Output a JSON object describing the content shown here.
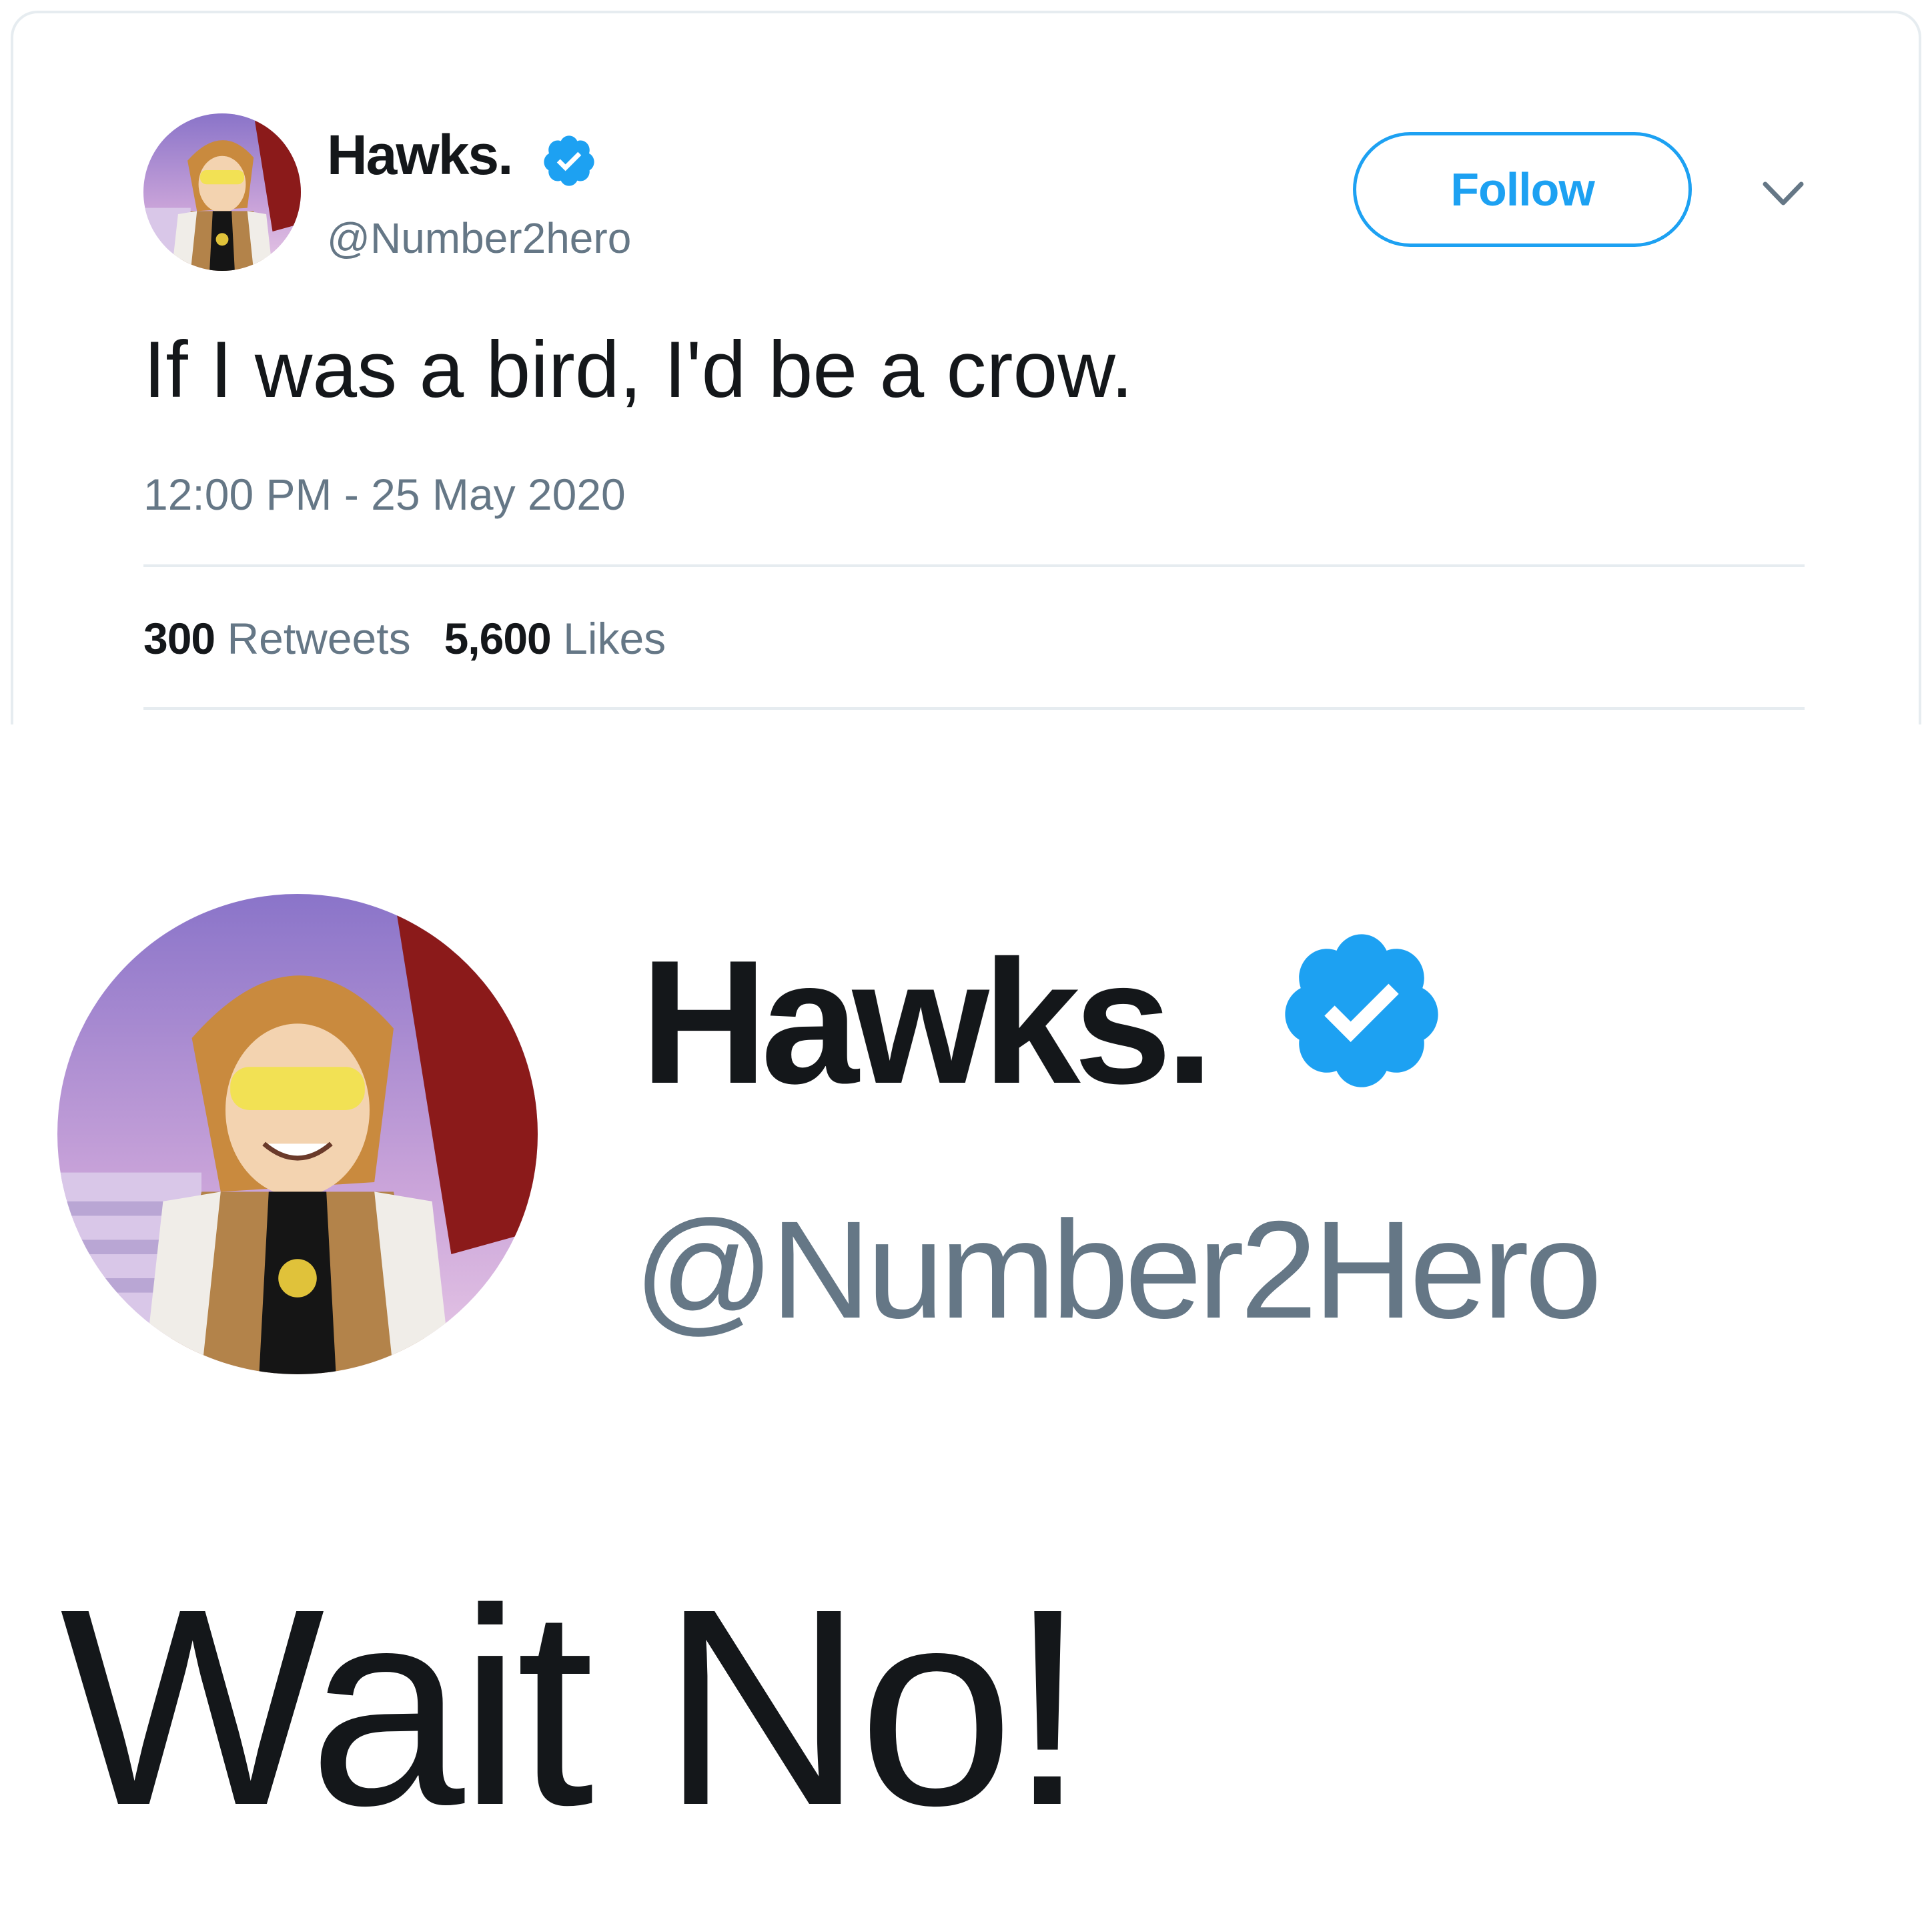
{
  "tweet": {
    "display_name": "Hawks.",
    "handle": "@Number2hero",
    "verified_icon": "verified-badge-icon",
    "follow_label": "Follow",
    "menu_icon": "chevron-down-icon",
    "text": "If I was a bird, I'd be a crow.",
    "timestamp": "12:00 PM - 25 May 2020",
    "stats": {
      "retweets_count": "300",
      "retweets_label": "Retweets",
      "likes_count": "5,600",
      "likes_label": "Likes"
    }
  },
  "zoomed_profile": {
    "display_name": "Hawks.",
    "handle": "@Number2Hero",
    "verified_icon": "verified-badge-icon"
  },
  "caption": "Wait No!",
  "colors": {
    "twitter_blue": "#1da1f2",
    "text_primary": "#14171a",
    "text_secondary": "#657786",
    "divider": "#e6ecf0"
  }
}
